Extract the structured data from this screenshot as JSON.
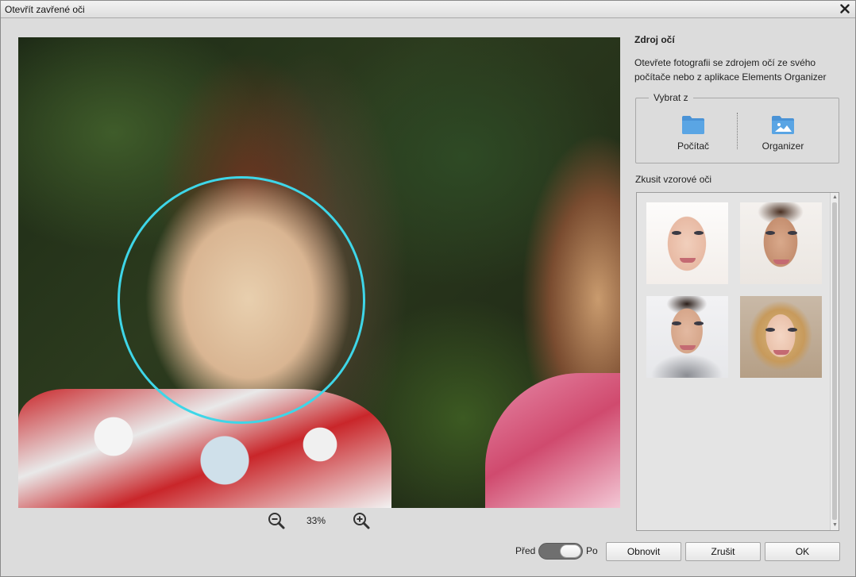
{
  "window": {
    "title": "Otevřít zavřené oči"
  },
  "zoom": {
    "value": "33%",
    "icons": [
      "zoom-out-icon",
      "zoom-in-icon"
    ]
  },
  "side": {
    "title": "Zdroj očí",
    "description": "Otevřete fotografii se zdrojem očí ze svého počítače nebo z aplikace Elements Organizer",
    "select_from": {
      "legend": "Vybrat z",
      "computer_label": "Počítač",
      "organizer_label": "Organizer"
    },
    "try_samples_label": "Zkusit vzorové oči"
  },
  "footer": {
    "before_label": "Před",
    "after_label": "Po",
    "reset_label": "Obnovit",
    "cancel_label": "Zrušit",
    "ok_label": "OK"
  },
  "colors": {
    "face_circle": "#3ed6e8",
    "folder_blue": "#4a93d6"
  }
}
